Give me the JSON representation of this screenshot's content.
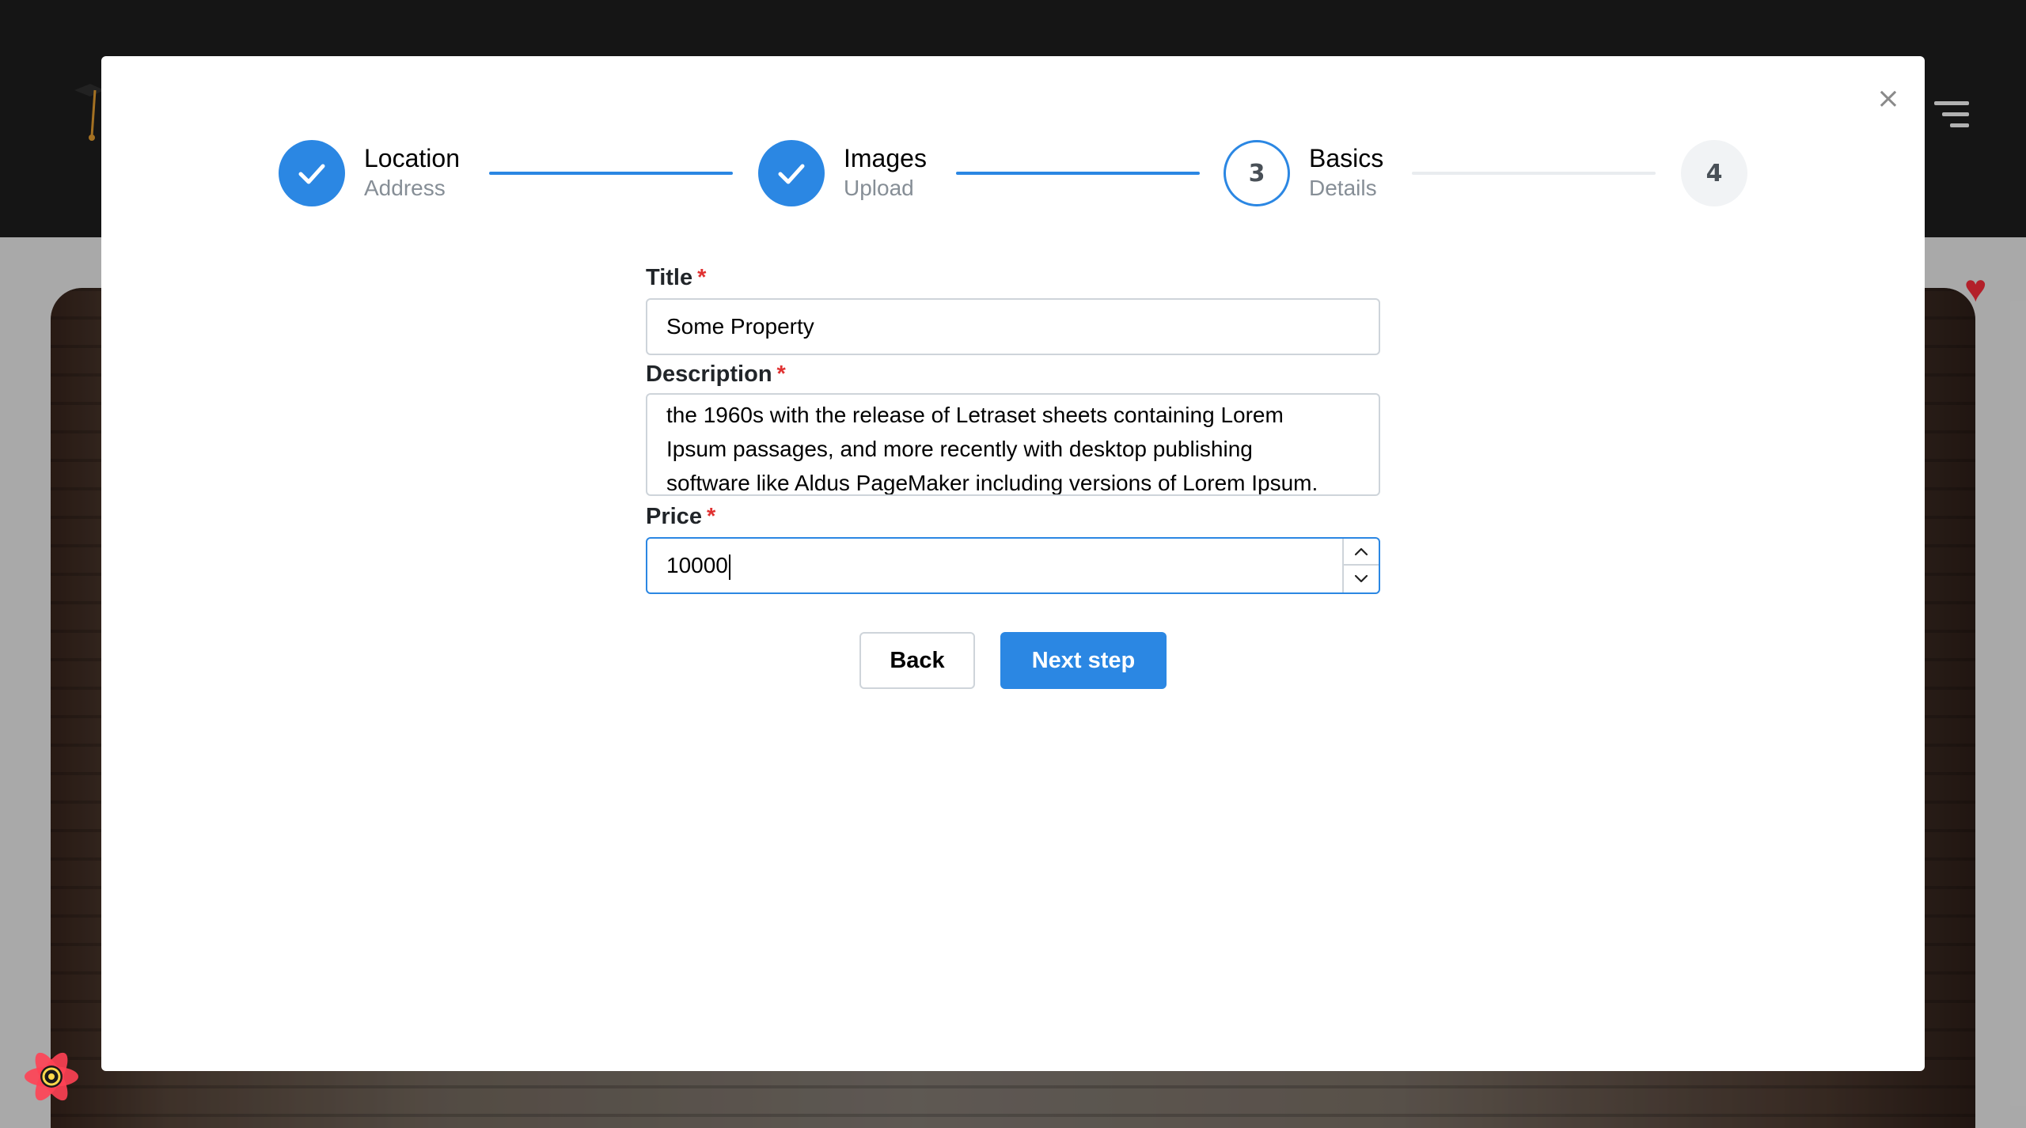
{
  "stepper": {
    "steps": [
      {
        "label": "Location",
        "description": "Address",
        "state": "completed"
      },
      {
        "label": "Images",
        "description": "Upload",
        "state": "completed"
      },
      {
        "label": "Basics",
        "description": "Details",
        "state": "active",
        "number": "3"
      },
      {
        "label": "",
        "description": "",
        "state": "upcoming",
        "number": "4"
      }
    ]
  },
  "form": {
    "title": {
      "label": "Title",
      "required_mark": "*",
      "value": "Some Property"
    },
    "description": {
      "label": "Description",
      "required_mark": "*",
      "visible_lines": [
        "the 1960s with the release of Letraset sheets containing Lorem",
        "Ipsum passages, and more recently with desktop publishing",
        "software like Aldus PageMaker including versions of Lorem Ipsum."
      ]
    },
    "price": {
      "label": "Price",
      "required_mark": "*",
      "value": "10000"
    }
  },
  "actions": {
    "back_label": "Back",
    "next_label": "Next step"
  },
  "icons": {
    "close": "close-icon",
    "check": "check-icon",
    "spin_up": "chevron-up-icon",
    "spin_down": "chevron-down-icon",
    "menu": "hamburger-menu-icon",
    "favorite": "heart-icon",
    "devtools": "react-query-devtools-icon"
  },
  "colors": {
    "accent": "#2b87e3",
    "required": "#e03131",
    "favorite": "#b3202a"
  }
}
